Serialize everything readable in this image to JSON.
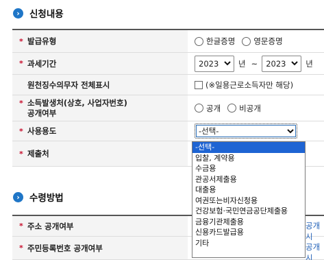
{
  "section1": {
    "icon": "chevron-right-icon",
    "title": "신청내용"
  },
  "rows": {
    "issue_type": {
      "label": "발급유형",
      "options": [
        "한글증명",
        "영문증명"
      ]
    },
    "tax_period": {
      "label": "과세기간",
      "from_year": "2023",
      "from_unit": "년",
      "sep": "~",
      "to_year": "2023",
      "to_unit": "년"
    },
    "withholding": {
      "label": "원천징수의무자 전체표시",
      "check_label": "(※일용근로소득자만 해당)"
    },
    "disclosure": {
      "label_line1": "소득발생처(상호, 사업자번호)",
      "label_line2": "공개여부",
      "options": [
        "공개",
        "비공개"
      ]
    },
    "purpose": {
      "label": "사용용도",
      "selected": "-선택-"
    },
    "submit_to": {
      "label": "제출처"
    }
  },
  "dropdown": {
    "items": [
      "-선택-",
      "입찰, 계약용",
      "수금용",
      "관공서제출용",
      "대출용",
      "여권또는비자신청용",
      "건강보험·국민연금공단제출용",
      "금융기관제출용",
      "신용카드발급용",
      "기타"
    ],
    "selected_index": 0
  },
  "section2": {
    "icon": "chevron-right-icon",
    "title": "수령방법"
  },
  "rows2": {
    "address": {
      "label": "주소 공개여부",
      "peek": "공개시"
    },
    "rrn": {
      "label": "주민등록번호 공개여부",
      "peek": "공개시"
    }
  },
  "colors": {
    "accent": "#1f76c7",
    "required": "#c8102e",
    "dropdown_highlight": "#1e64d3"
  }
}
